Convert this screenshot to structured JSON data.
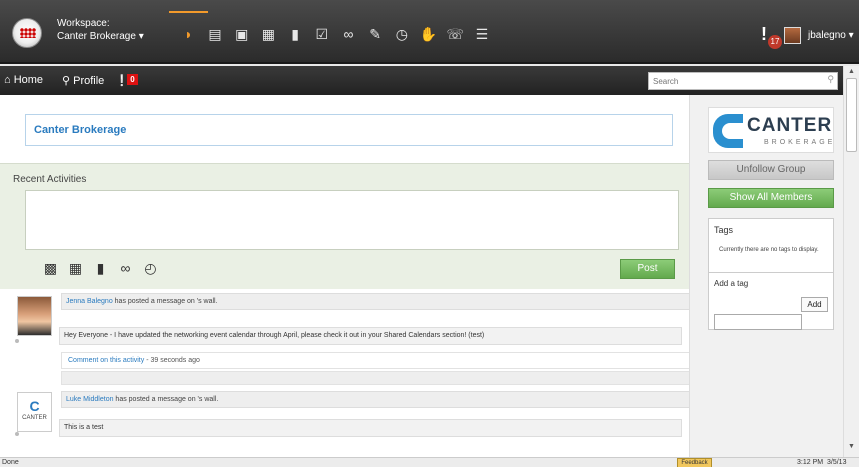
{
  "topbar": {
    "workspace_label": "Workspace:",
    "workspace_name": "Canter Brokerage ▾",
    "nav_icons": [
      {
        "icon": "rss-icon",
        "glyph": "◗",
        "active": true
      },
      {
        "icon": "calculator-icon",
        "glyph": "▤",
        "active": false
      },
      {
        "icon": "contact-card-icon",
        "glyph": "▣",
        "active": false
      },
      {
        "icon": "calendar-icon",
        "glyph": "▦",
        "active": false
      },
      {
        "icon": "document-icon",
        "glyph": "▮",
        "active": false
      },
      {
        "icon": "checkbox-icon",
        "glyph": "☑",
        "active": false
      },
      {
        "icon": "link-icon",
        "glyph": "∞",
        "active": false
      },
      {
        "icon": "edit-icon",
        "glyph": "✎",
        "active": false
      },
      {
        "icon": "clock-icon",
        "glyph": "◷",
        "active": false
      },
      {
        "icon": "handshake-icon",
        "glyph": "✋",
        "active": false
      },
      {
        "icon": "chat-icon",
        "glyph": "☏",
        "active": false
      },
      {
        "icon": "database-icon",
        "glyph": "☰",
        "active": false
      }
    ],
    "alert_count": "17",
    "username": "jbalegno ▾"
  },
  "subnav": {
    "home": "⌂ Home",
    "profile": "⚲ Profile",
    "badge": "0",
    "search_placeholder": "Search"
  },
  "group": {
    "title": "Canter Brokerage"
  },
  "recent": {
    "title": "Recent Activities",
    "tools": [
      {
        "icon": "contact-book-icon",
        "glyph": "▩"
      },
      {
        "icon": "calendar-clock-icon",
        "glyph": "▦"
      },
      {
        "icon": "document-icon",
        "glyph": "▮"
      },
      {
        "icon": "link-icon",
        "glyph": "∞"
      },
      {
        "icon": "schedule-icon",
        "glyph": "◴"
      }
    ],
    "post_label": "Post"
  },
  "feed": [
    {
      "author": "Jenna Balegno",
      "action": " has posted a message on 's wall.",
      "message": "Hey Everyone - I have updated the networking event calendar through April, please check it out in your Shared Calendars section! (test)",
      "comment_link": "Comment on this activity",
      "time": " - 39 seconds ago"
    },
    {
      "author": "Luke Middleton",
      "action": " has posted a message on 's wall.",
      "message": "This is a test",
      "avatar_mark": "C",
      "avatar_text": "CANTER"
    }
  ],
  "sidebar": {
    "brand_name": "CANTER",
    "brand_sub": "BROKERAGE",
    "unfollow_label": "Unfollow Group",
    "show_members_label": "Show All Members",
    "tags_title": "Tags",
    "tags_empty": "Currently there are no tags to display.",
    "add_tag_label": "Add a tag",
    "add_button": "Add"
  },
  "statusbar": {
    "done": "Done",
    "feedback": "Feedback",
    "time": "3:12 PM",
    "date": "3/5/13"
  },
  "colors": {
    "accent_orange": "#f39a2b",
    "link_blue": "#2a7bbf",
    "button_green": "#63a94d",
    "alert_red": "#c0392b"
  }
}
